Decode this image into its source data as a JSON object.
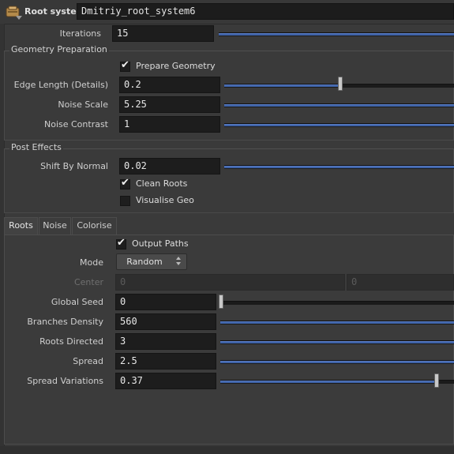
{
  "header": {
    "node_type": "Root system",
    "node_name": "Dmitriy_root_system6",
    "icon": "root-node-icon"
  },
  "params": {
    "iterations": {
      "label": "Iterations",
      "value": "15",
      "fraction": 1.0
    }
  },
  "geometry_preparation": {
    "title": "Geometry Preparation",
    "prepare_geometry": {
      "label": "Prepare Geometry",
      "checked": true
    },
    "edge_length": {
      "label": "Edge Length (Details)",
      "value": "0.2",
      "fraction": 0.51
    },
    "noise_scale": {
      "label": "Noise Scale",
      "value": "5.25",
      "fraction": 1.0
    },
    "noise_contrast": {
      "label": "Noise Contrast",
      "value": "1",
      "fraction": 1.0
    }
  },
  "post_effects": {
    "title": "Post Effects",
    "shift_by_normal": {
      "label": "Shift By Normal",
      "value": "0.02",
      "fraction": 1.0
    },
    "clean_roots": {
      "label": "Clean Roots",
      "checked": true
    },
    "visualise_geo": {
      "label": "Visualise Geo",
      "checked": false
    }
  },
  "tabs": [
    {
      "label": "Roots",
      "active": true
    },
    {
      "label": "Noise",
      "active": false
    },
    {
      "label": "Colorise",
      "active": false
    }
  ],
  "roots": {
    "output_paths": {
      "label": "Output Paths",
      "checked": true
    },
    "mode": {
      "label": "Mode",
      "value": "Random"
    },
    "center": {
      "label": "Center",
      "x": "0",
      "y": "0"
    },
    "global_seed": {
      "label": "Global Seed",
      "value": "0",
      "fraction": 0.0
    },
    "branches_density": {
      "label": "Branches Density",
      "value": "560",
      "fraction": 1.0
    },
    "roots_directed": {
      "label": "Roots Directed",
      "value": "3",
      "fraction": 1.0
    },
    "spread": {
      "label": "Spread",
      "value": "2.5",
      "fraction": 1.0
    },
    "spread_variations": {
      "label": "Spread Variations",
      "value": "0.37",
      "fraction": 0.92
    }
  },
  "colors": {
    "accent": "#3f63a8",
    "background": "#3a3a3a",
    "field": "#1d1d1d"
  }
}
